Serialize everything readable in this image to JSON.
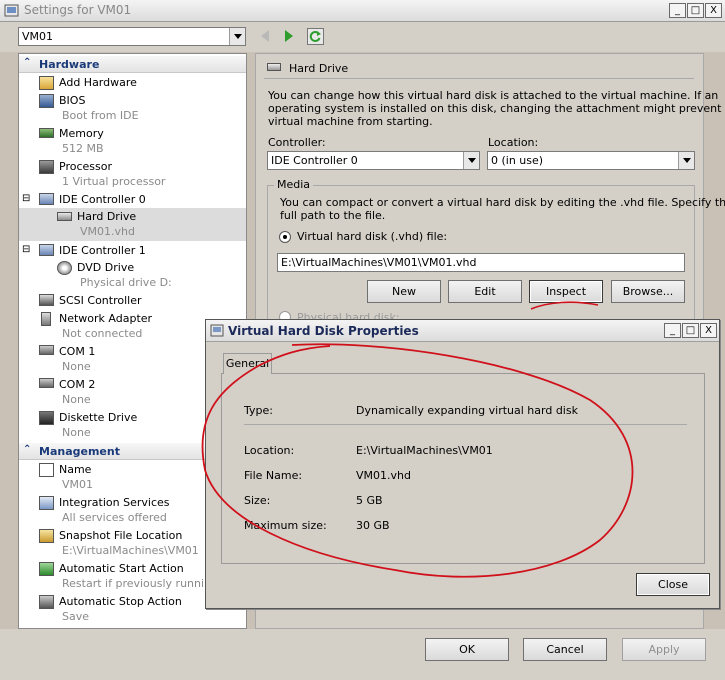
{
  "window": {
    "title": "Settings for VM01",
    "controls": {
      "minimize": "_",
      "maximize": "□",
      "close": "X"
    }
  },
  "toolbar": {
    "vm_selector_value": "VM01"
  },
  "tree": {
    "hardware_header": "Hardware",
    "hardware": [
      {
        "label": "Add Hardware",
        "sub": "",
        "icon": "add-hardware-icon"
      },
      {
        "label": "BIOS",
        "sub": "Boot from IDE",
        "icon": "bios-icon"
      },
      {
        "label": "Memory",
        "sub": "512 MB",
        "icon": "memory-icon"
      },
      {
        "label": "Processor",
        "sub": "1 Virtual processor",
        "icon": "processor-icon"
      },
      {
        "label": "IDE Controller 0",
        "sub": "",
        "icon": "ide-controller-icon"
      },
      {
        "label": "Hard Drive",
        "sub": "VM01.vhd",
        "icon": "hard-drive-icon"
      },
      {
        "label": "IDE Controller 1",
        "sub": "",
        "icon": "ide-controller-icon"
      },
      {
        "label": "DVD Drive",
        "sub": "Physical drive D:",
        "icon": "dvd-drive-icon"
      },
      {
        "label": "SCSI Controller",
        "sub": "",
        "icon": "scsi-controller-icon"
      },
      {
        "label": "Network Adapter",
        "sub": "Not connected",
        "icon": "network-adapter-icon"
      },
      {
        "label": "COM 1",
        "sub": "None",
        "icon": "com-port-icon"
      },
      {
        "label": "COM 2",
        "sub": "None",
        "icon": "com-port-icon"
      },
      {
        "label": "Diskette Drive",
        "sub": "None",
        "icon": "diskette-drive-icon"
      }
    ],
    "management_header": "Management",
    "management": [
      {
        "label": "Name",
        "sub": "VM01",
        "icon": "name-icon"
      },
      {
        "label": "Integration Services",
        "sub": "All services offered",
        "icon": "integration-services-icon"
      },
      {
        "label": "Snapshot File Location",
        "sub": "E:\\VirtualMachines\\VM01",
        "icon": "snapshot-location-icon"
      },
      {
        "label": "Automatic Start Action",
        "sub": "Restart if previously running",
        "icon": "start-action-icon"
      },
      {
        "label": "Automatic Stop Action",
        "sub": "Save",
        "icon": "stop-action-icon"
      }
    ]
  },
  "panel": {
    "header": "Hard Drive",
    "description": [
      "You can change how this virtual hard disk is attached to the virtual machine. If an",
      "operating system is installed on this disk, changing the attachment might prevent the",
      "virtual machine from starting."
    ],
    "controller_label": "Controller:",
    "controller_value": "IDE Controller 0",
    "location_label": "Location:",
    "location_value": "0 (in use)",
    "media_label": "Media",
    "media_description": [
      "You can compact or convert a virtual hard disk by editing the .vhd file. Specify the",
      "full path to the file."
    ],
    "vhd_radio_label": "Virtual hard disk (.vhd) file:",
    "vhd_path": "E:\\VirtualMachines\\VM01\\VM01.vhd",
    "buttons": {
      "new": "New",
      "edit": "Edit",
      "inspect": "Inspect",
      "browse": "Browse..."
    },
    "physical_radio_label": "Physical hard disk:"
  },
  "dialog": {
    "title": "Virtual Hard Disk Properties",
    "tab": "General",
    "type_label": "Type:",
    "type_value": "Dynamically expanding virtual hard disk",
    "location_label": "Location:",
    "location_value": "E:\\VirtualMachines\\VM01",
    "filename_label": "File Name:",
    "filename_value": "VM01.vhd",
    "size_label": "Size:",
    "size_value": "5 GB",
    "maxsize_label": "Maximum size:",
    "maxsize_value": "30 GB",
    "close_button": "Close"
  },
  "footer": {
    "ok": "OK",
    "cancel": "Cancel",
    "apply": "Apply"
  },
  "colors": {
    "annotation": "#d0101a",
    "section_header_text": "#1a3a7a",
    "nav_green": "#2e9d2e"
  }
}
